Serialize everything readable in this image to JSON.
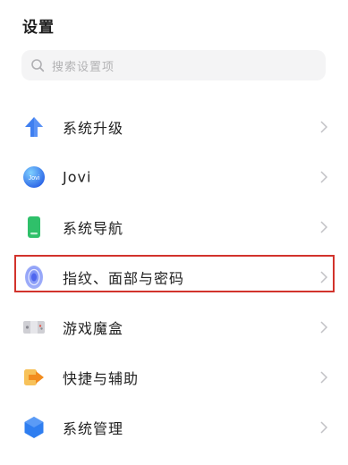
{
  "header": {
    "title": "设置"
  },
  "search": {
    "placeholder": "搜索设置项"
  },
  "settings": {
    "items": [
      {
        "label": "系统升级",
        "icon": "upgrade-arrow-icon"
      },
      {
        "label": "Jovi",
        "icon": "jovi-icon",
        "icon_text": "Jovi"
      },
      {
        "label": "系统导航",
        "icon": "navigation-phone-icon"
      },
      {
        "label": "指纹、面部与密码",
        "icon": "fingerprint-icon"
      },
      {
        "label": "游戏魔盒",
        "icon": "game-box-icon"
      },
      {
        "label": "快捷与辅助",
        "icon": "shortcut-assist-icon",
        "highlighted": true
      },
      {
        "label": "系统管理",
        "icon": "system-management-icon"
      }
    ]
  },
  "colors": {
    "highlight_border": "#d2332c",
    "upgrade_blue": "#3f7ff0",
    "nav_green": "#2fc06a",
    "shortcut_orange": "#f5a52a",
    "manage_blue": "#2f7ef0"
  }
}
